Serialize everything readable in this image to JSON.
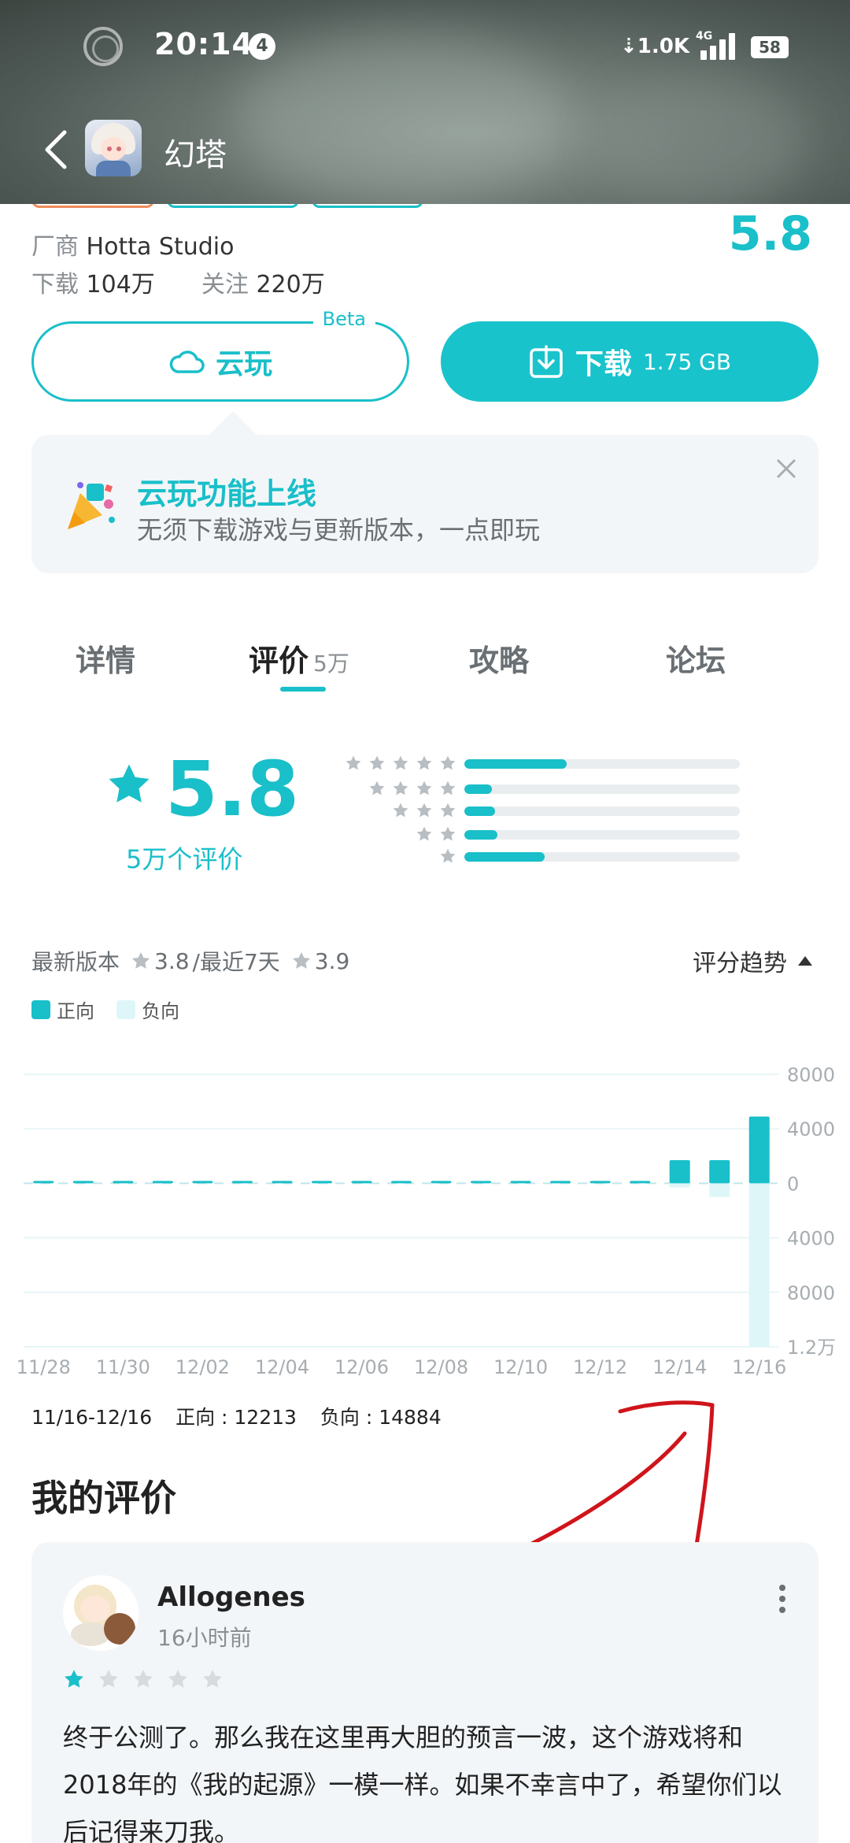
{
  "status_bar": {
    "time": "20:14",
    "notification_count": "4",
    "net_speed": "1.0K",
    "network": "4G",
    "battery": "58"
  },
  "app_bar": {
    "title": "幻塔"
  },
  "header": {
    "vendor_label": "厂商",
    "vendor": "Hotta Studio",
    "downloads_label": "下载",
    "downloads": "104万",
    "follows_label": "关注",
    "follows": "220万",
    "rating": "5.8"
  },
  "actions": {
    "cloud_play": "云玩",
    "beta": "Beta",
    "download": "下载",
    "download_size": "1.75 GB"
  },
  "promo": {
    "title": "云玩功能上线",
    "subtitle": "无须下载游戏与更新版本，一点即玩"
  },
  "tabs": [
    {
      "label": "详情"
    },
    {
      "label": "评价",
      "count": "5万",
      "active": true
    },
    {
      "label": "攻略"
    },
    {
      "label": "论坛"
    }
  ],
  "rating_summary": {
    "score": "5.8",
    "count_text": "5万个评价",
    "distribution": [
      {
        "stars": 5,
        "fraction": 0.37
      },
      {
        "stars": 4,
        "fraction": 0.1
      },
      {
        "stars": 3,
        "fraction": 0.11
      },
      {
        "stars": 2,
        "fraction": 0.12
      },
      {
        "stars": 1,
        "fraction": 0.29
      }
    ]
  },
  "trend": {
    "latest_label": "最新版本",
    "latest_score": "3.8",
    "recent_label": "/最近7天",
    "recent_score": "3.9",
    "toggle_label": "评分趋势",
    "legend_positive": "正向",
    "legend_negative": "负向",
    "footer_range": "11/16-12/16",
    "footer_positive": "正向 : 12213",
    "footer_negative": "负向 : 14884"
  },
  "chart_data": {
    "type": "bar",
    "xlabel": "",
    "ylabel": "",
    "categories": [
      "11/28",
      "11/29",
      "11/30",
      "12/01",
      "12/02",
      "12/03",
      "12/04",
      "12/05",
      "12/06",
      "12/07",
      "12/08",
      "12/09",
      "12/10",
      "12/11",
      "12/12",
      "12/13",
      "12/14",
      "12/15",
      "12/16"
    ],
    "x_tick_labels": [
      "11/28",
      "11/30",
      "12/02",
      "12/04",
      "12/06",
      "12/08",
      "12/10",
      "12/12",
      "12/14",
      "12/16"
    ],
    "y_tick_labels": [
      "8000",
      "4000",
      "0",
      "4000",
      "8000",
      "1.2万"
    ],
    "ylim": [
      -12000,
      8000
    ],
    "series": [
      {
        "name": "正向",
        "color": "#19bfc9",
        "values": [
          80,
          80,
          80,
          80,
          80,
          80,
          80,
          80,
          80,
          80,
          80,
          80,
          80,
          80,
          80,
          80,
          1700,
          1700,
          4900
        ]
      },
      {
        "name": "负向",
        "color": "#dff6f8",
        "values": [
          0,
          0,
          0,
          0,
          0,
          0,
          0,
          0,
          0,
          0,
          0,
          0,
          0,
          0,
          0,
          0,
          -300,
          -1000,
          -12000
        ]
      }
    ],
    "grid": true,
    "legend": "top-left"
  },
  "my_review": {
    "section_title": "我的评价",
    "username": "Allogenes",
    "time": "16小时前",
    "rating": 1,
    "text": "终于公测了。那么我在这里再大胆的预言一波，这个游戏将和2018年的《我的起源》一模一样。如果不幸言中了，希望你们以后记得来刀我。"
  },
  "colors": {
    "accent": "#19bfc9",
    "accent_light": "#dff6f8",
    "annotation": "#d0141b"
  },
  "icons": [
    "back-icon",
    "cloud-icon",
    "download-icon",
    "party-popper-icon",
    "close-icon",
    "star-icon",
    "triangle-up-icon",
    "more-icon"
  ]
}
